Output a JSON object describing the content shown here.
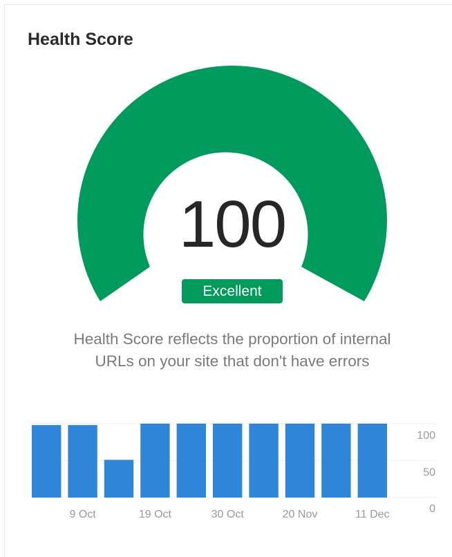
{
  "widget": {
    "title": "Health Score",
    "score": "100",
    "badge_label": "Excellent",
    "description_line1": "Health Score reflects the proportion of internal",
    "description_line2": "URLs on your site that don't have errors"
  },
  "colors": {
    "gauge_fill": "#009b5c",
    "badge_bg": "#009b5c",
    "bar_fill": "#2f86d8"
  },
  "chart_data": {
    "type": "bar",
    "categories": [
      "",
      "9 Oct",
      "",
      "19 Oct",
      "",
      "30 Oct",
      "",
      "20 Nov",
      "",
      "11 Dec"
    ],
    "x_tick_labels": [
      "9 Oct",
      "19 Oct",
      "30 Oct",
      "20 Nov",
      "11 Dec"
    ],
    "values": [
      98,
      98,
      51,
      100,
      100,
      100,
      100,
      100,
      100,
      100
    ],
    "y_tick_labels": [
      "100",
      "50",
      "0"
    ],
    "ylim": [
      0,
      100
    ],
    "grid": true,
    "axis_position": "right"
  }
}
